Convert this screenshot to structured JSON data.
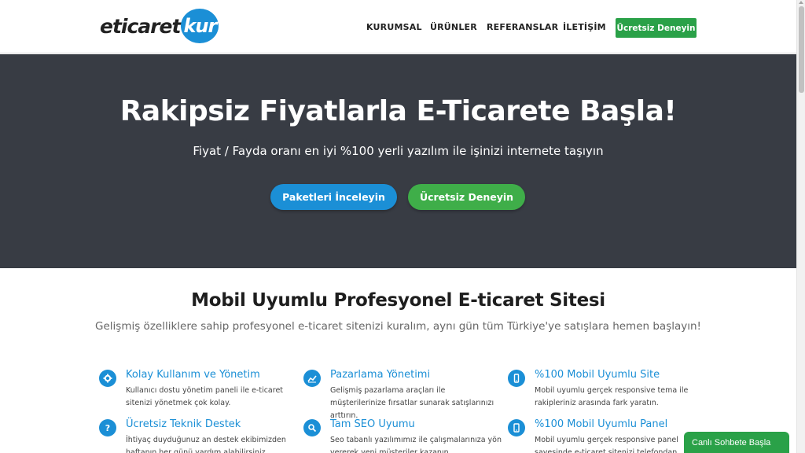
{
  "header": {
    "logo_text": "eticaret",
    "logo_badge": "kur",
    "nav": [
      "KURUMSAL",
      "ÜRÜNLER",
      "REFERANSLAR",
      "İLETİŞİM"
    ],
    "cta": "Ücretsiz Deneyin"
  },
  "hero": {
    "title": "Rakipsiz Fiyatlarla E-Ticarete Başla!",
    "subtitle": "Fiyat / Fayda oranı en iyi %100 yerli yazılım ile işinizi internete taşıyın",
    "btn_packages": "Paketleri İnceleyin",
    "btn_try": "Ücretsiz Deneyin"
  },
  "section": {
    "title": "Mobil Uyumlu Profesyonel E-ticaret Sitesi",
    "subtitle": "Gelişmiş özelliklere sahip profesyonel e-ticaret sitenizi kuralım, aynı gün tüm Türkiye'ye satışlara hemen başlayın!"
  },
  "features": [
    {
      "icon": "gear-icon",
      "title": "Kolay Kullanım ve Yönetim",
      "desc": "Kullanıcı dostu yönetim paneli ile e-ticaret sitenizi yönetmek çok kolay."
    },
    {
      "icon": "chart-icon",
      "title": "Pazarlama Yönetimi",
      "desc": "Gelişmiş pazarlama araçları ile müşterilerinize fırsatlar sunarak satışlarınızı arttırın."
    },
    {
      "icon": "mobile-icon",
      "title": "%100 Mobil Uyumlu Site",
      "desc": "Mobil uyumlu gerçek responsive tema ile rakipleriniz arasında fark yaratın."
    },
    {
      "icon": "question-icon",
      "title": "Ücretsiz Teknik Destek",
      "desc": "İhtiyaç duyduğunuz an destek ekibimizden haftanın her günü yardım alabilirsiniz."
    },
    {
      "icon": "search-icon",
      "title": "Tam SEO Uyumu",
      "desc": "Seo tabanlı yazılımımız ile çalışmalarınıza yön vererek yeni müşteriler kazanın."
    },
    {
      "icon": "tablet-icon",
      "title": "%100 Mobil Uyumlu Panel",
      "desc": "Mobil uyumlu gerçek responsive panel sayesinde e-ticaret sitenizi telefondan yönetin."
    }
  ],
  "chat": {
    "label": "Canlı Sohbete Başla"
  },
  "colors": {
    "accent": "#1b8fd6",
    "green": "#2aa148",
    "hero_bg": "#383c44"
  }
}
